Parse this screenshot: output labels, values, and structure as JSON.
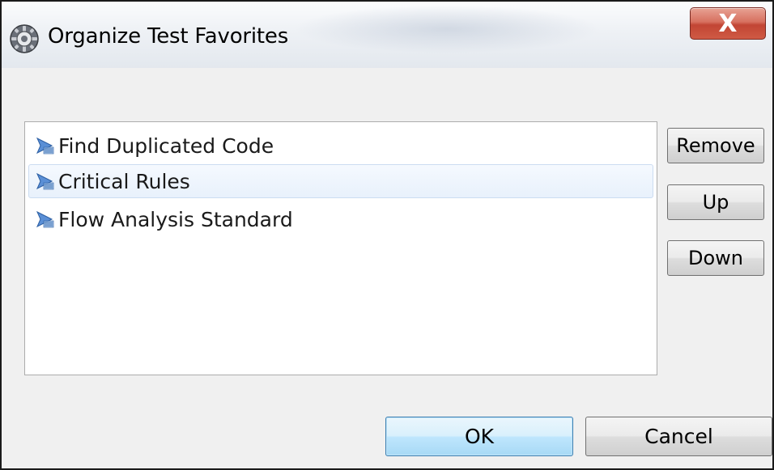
{
  "window": {
    "title": "Organize Test Favorites",
    "icon": "gear-icon",
    "close_label": "X"
  },
  "favorites": {
    "items": [
      {
        "label": "Find Duplicated Code",
        "icon": "test-config-icon",
        "selected": false
      },
      {
        "label": "Critical Rules",
        "icon": "test-config-icon",
        "selected": true
      },
      {
        "label": "Flow Analysis Standard",
        "icon": "test-config-icon",
        "selected": false
      }
    ]
  },
  "actions": {
    "remove_label": "Remove",
    "up_label": "Up",
    "down_label": "Down"
  },
  "footer": {
    "ok_label": "OK",
    "cancel_label": "Cancel"
  },
  "colors": {
    "close_button": "#c9503c",
    "selection": "#e8f1fc",
    "ok_button": "#bee6fd"
  }
}
